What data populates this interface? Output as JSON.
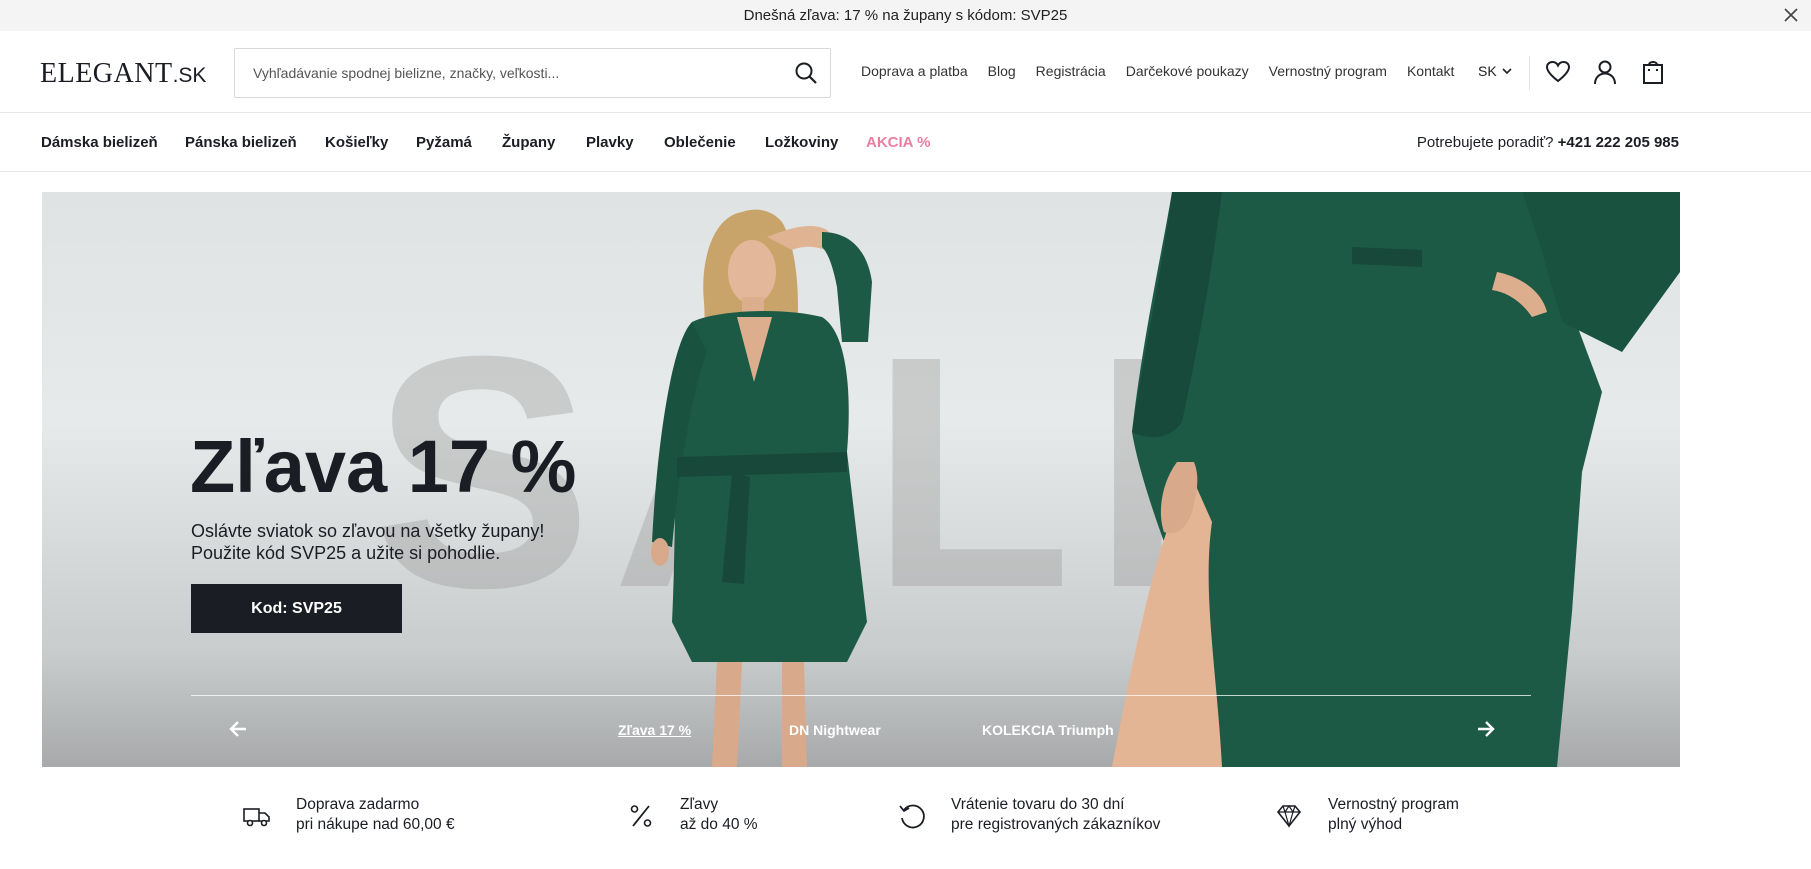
{
  "topbar": {
    "text": "Dnešná zľava: 17 % na župany s kódom: SVP25",
    "close_icon": "close-icon"
  },
  "header": {
    "logo_main": "ELEGANT",
    "logo_suffix": ".SK",
    "search": {
      "placeholder": "Vyhľadávanie spodnej bielizne, značky, veľkosti...",
      "value": ""
    },
    "links": [
      "Doprava a platba",
      "Blog",
      "Registrácia",
      "Darčekové poukazy",
      "Vernostný program",
      "Kontakt"
    ],
    "language": "SK",
    "icons": [
      "heart-icon",
      "user-icon",
      "cart-icon"
    ]
  },
  "categories": [
    "Dámska bielizeň",
    "Pánska bielizeň",
    "Košieľky",
    "Pyžamá",
    "Župany",
    "Plavky",
    "Oblečenie",
    "Ložkoviny",
    "AKCIA %"
  ],
  "help": {
    "label": "Potrebujete poradiť?",
    "phone": "+421 222 205 985"
  },
  "hero": {
    "background_word": "SALE",
    "title": "Zľava 17 %",
    "subtitle_line1": "Oslávte sviatok so zľavou na všetky župany!",
    "subtitle_line2": "Použite kód SVP25 a užite si pohodlie.",
    "cta": "Kod: SVP25",
    "slides": [
      "Zľava 17 %",
      "DN Nightwear",
      "KOLEKCIA Triumph"
    ],
    "active_slide": 0
  },
  "benefits": [
    {
      "icon": "truck-icon",
      "line1": "Doprava zadarmo",
      "line2": "pri nákupe nad 60,00 €"
    },
    {
      "icon": "percent-icon",
      "line1": "Zľavy",
      "line2": "až do 40 %"
    },
    {
      "icon": "return-icon",
      "line1": "Vrátenie tovaru do 30 dní",
      "line2": "pre registrovaných zákazníkov"
    },
    {
      "icon": "diamond-icon",
      "line1": "Vernostný program",
      "line2": "plný výhod"
    }
  ],
  "colors": {
    "dark": "#1b1d24",
    "sale_pink": "#e97fa0",
    "robe_green": "#1d5a45"
  }
}
